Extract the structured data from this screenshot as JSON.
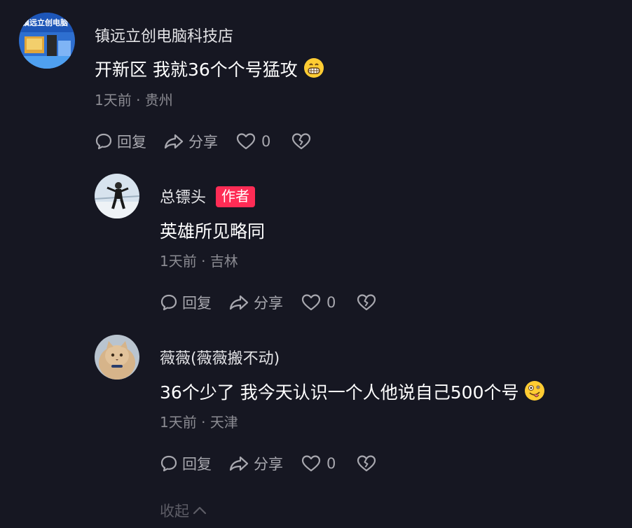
{
  "comments": [
    {
      "username": "镇远立创电脑科技店",
      "avatar_text": "镇远立创电脑",
      "text": "开新区 我就36个个号猛攻",
      "emoji": "grinning-face-icon",
      "time": "1天前",
      "location": "贵州",
      "reply_label": "回复",
      "share_label": "分享",
      "likes": "0"
    },
    {
      "username": "总镖头",
      "badge": "作者",
      "text": "英雄所见略同",
      "time": "1天前",
      "location": "吉林",
      "reply_label": "回复",
      "share_label": "分享",
      "likes": "0"
    },
    {
      "username": "薇薇(薇薇搬不动)",
      "text": "36个少了 我今天认识一个人他说自己500个号",
      "emoji": "zany-face-icon",
      "time": "1天前",
      "location": "天津",
      "reply_label": "回复",
      "share_label": "分享",
      "likes": "0"
    }
  ],
  "separator": "·",
  "collapse_label": "收起",
  "colors": {
    "background": "#161722",
    "badge": "#fe2c55",
    "meta": "#8b8b92",
    "action": "#a8a8af"
  }
}
